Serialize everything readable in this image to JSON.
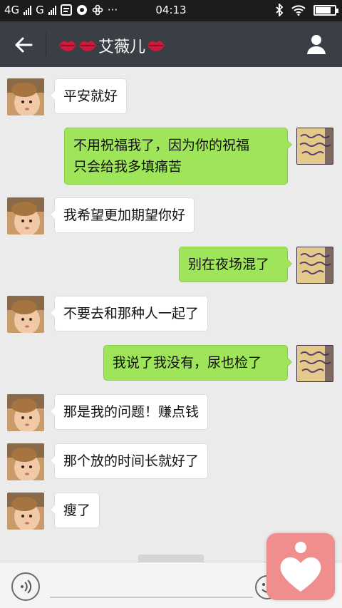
{
  "status_bar": {
    "network_1": "4G",
    "network_2": "G",
    "time": "04:13",
    "icons": [
      "signal-icon",
      "message-icon",
      "qq-icon",
      "flower-icon",
      "more-icon",
      "bluetooth-icon",
      "wifi-icon",
      "battery-icon"
    ],
    "battery_level": 0.8
  },
  "header": {
    "title": "艾薇儿",
    "back_icon": "arrow-left-icon",
    "profile_icon": "person-icon",
    "decoration_icons": [
      "lips-icon",
      "lips-icon",
      "lips-icon"
    ]
  },
  "messages": [
    {
      "side": "left",
      "text": "平安就好"
    },
    {
      "side": "right",
      "lines": [
        "不用祝福我了，因为你的祝福",
        "只会给我多填痛苦"
      ]
    },
    {
      "side": "left",
      "text": "我希望更加期望你好"
    },
    {
      "side": "right",
      "text": "别在夜场混了"
    },
    {
      "side": "left",
      "text": "不要去和那种人一起了"
    },
    {
      "side": "right",
      "text": "我说了我没有，尿也检了"
    },
    {
      "side": "left",
      "text": "那是我的问题！赚点钱"
    },
    {
      "side": "left",
      "text": "那个放的时间长就好了"
    },
    {
      "side": "left",
      "text": "瘦了"
    }
  ],
  "bottom_bar": {
    "voice_icon": "voice-icon",
    "emoji_icon": "emoji-icon",
    "floating_icon": "heart-person-icon"
  },
  "colors": {
    "status_bg": "#1c1c1c",
    "header_bg": "#3a3f45",
    "chat_bg": "#ebebeb",
    "bubble_right": "#9fe559",
    "bubble_left": "#ffffff",
    "float_button": "#f08e8e"
  }
}
